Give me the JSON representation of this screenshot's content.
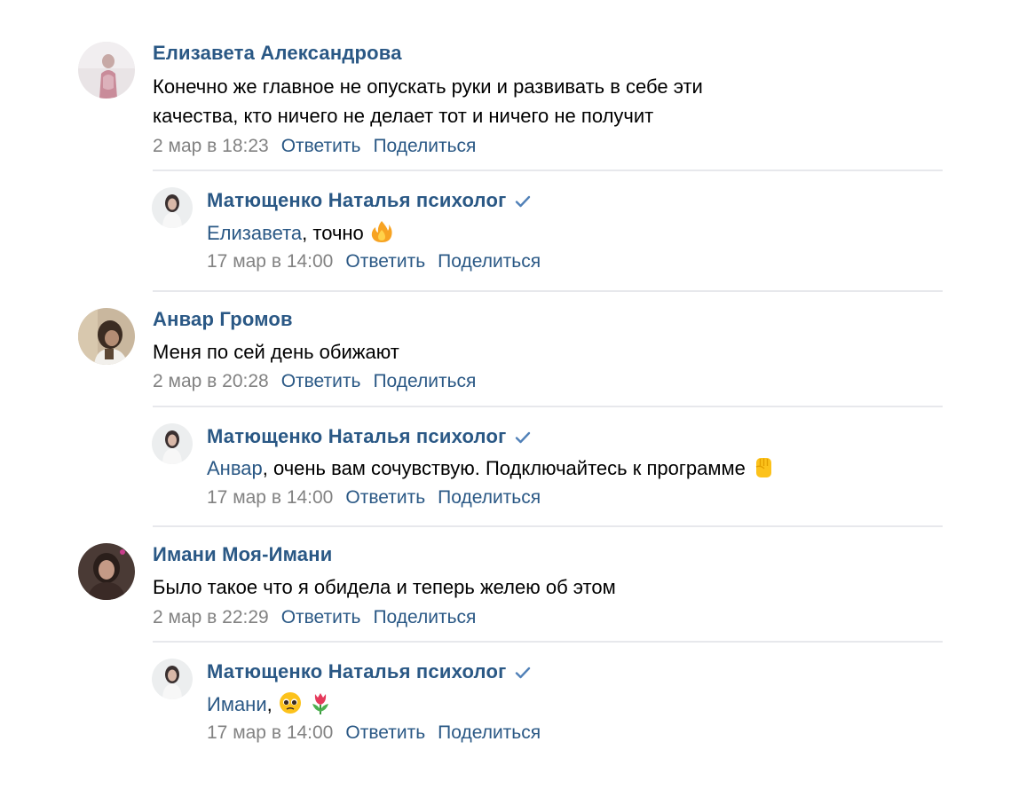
{
  "comments": [
    {
      "author": "Елизавета Александрова",
      "text_line1": "Конечно же главное не опускать руки и развивать в себе эти",
      "text_line2": "качества, кто ничего не делает тот и ничего не получит",
      "date": "2 мар в 18:23",
      "reply_label": "Ответить",
      "share_label": "Поделиться",
      "avatar_icon": "avatar-photo"
    },
    {
      "author": "Матющенко Наталья психолог",
      "verified_icon": "verified-check-icon",
      "mention": "Елизавета",
      "text": ", точно",
      "emoji": "fire-emoji",
      "date": "17 мар в 14:00",
      "reply_label": "Ответить",
      "share_label": "Поделиться"
    },
    {
      "author": "Анвар Громов",
      "text": "Меня по сей день обижают",
      "date": "2 мар в 20:28",
      "reply_label": "Ответить",
      "share_label": "Поделиться"
    },
    {
      "author": "Матющенко Наталья психолог",
      "verified_icon": "verified-check-icon",
      "mention": "Анвар",
      "text": ", очень вам сочувствую. Подключайтесь к программе",
      "emoji": "raised-fist-emoji",
      "date": "17 мар в 14:00",
      "reply_label": "Ответить",
      "share_label": "Поделиться"
    },
    {
      "author": "Имани Моя-Имани",
      "text": "Было такое что я обидела и теперь желею об этом",
      "date": "2 мар в 22:29",
      "reply_label": "Ответить",
      "share_label": "Поделиться"
    },
    {
      "author": "Матющенко Наталья психолог",
      "verified_icon": "verified-check-icon",
      "mention": "Имани",
      "text": ",",
      "emoji": "pleading-face-and-tulip-emoji",
      "date": "17 мар в 14:00",
      "reply_label": "Ответить",
      "share_label": "Поделиться"
    }
  ],
  "colors": {
    "link": "#2a5885",
    "meta": "#828282",
    "divider": "#e7e8ec",
    "verified": "#5181b8"
  }
}
